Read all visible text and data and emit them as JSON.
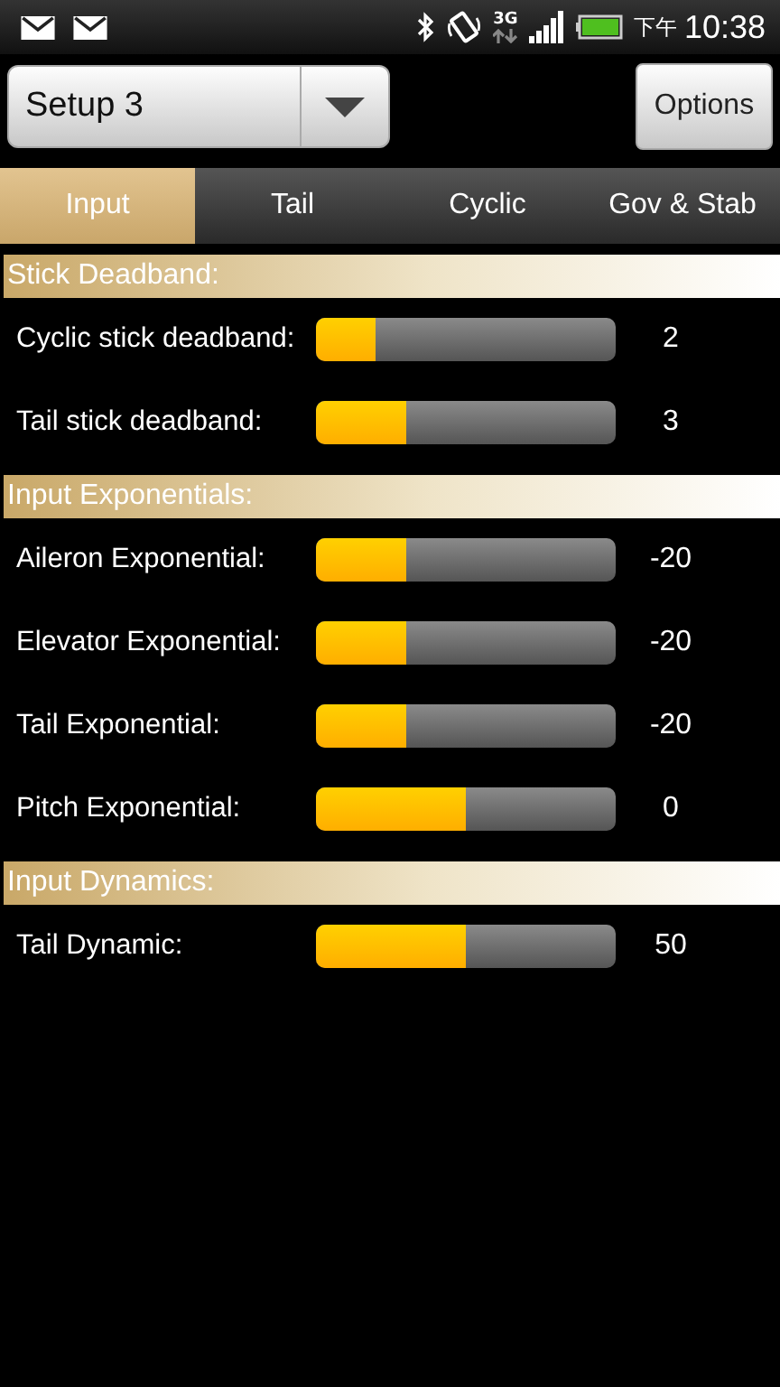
{
  "status_bar": {
    "ampm": "下午",
    "time": "10:38",
    "network": "3G"
  },
  "setup_select": {
    "value": "Setup 3"
  },
  "options_button": "Options",
  "tabs": [
    {
      "label": "Input",
      "selected": true
    },
    {
      "label": "Tail",
      "selected": false
    },
    {
      "label": "Cyclic",
      "selected": false
    },
    {
      "label": "Gov & Stab",
      "selected": false
    }
  ],
  "sections": [
    {
      "title": "Stick Deadband:",
      "rows": [
        {
          "label": "Cyclic stick deadband:",
          "level": 0.2,
          "reading": "2"
        },
        {
          "label": "Tail stick deadband:",
          "level": 0.3,
          "reading": "3"
        }
      ]
    },
    {
      "title": "Input Exponentials:",
      "rows": [
        {
          "label": "Aileron Exponential:",
          "level": 0.3,
          "reading": "-20"
        },
        {
          "label": "Elevator Exponential:",
          "level": 0.3,
          "reading": "-20"
        },
        {
          "label": "Tail Exponential:",
          "level": 0.3,
          "reading": "-20"
        },
        {
          "label": "Pitch Exponential:",
          "level": 0.5,
          "reading": "0"
        }
      ]
    },
    {
      "title": "Input Dynamics:",
      "rows": [
        {
          "label": "Tail Dynamic:",
          "level": 0.5,
          "reading": "50"
        }
      ]
    }
  ]
}
